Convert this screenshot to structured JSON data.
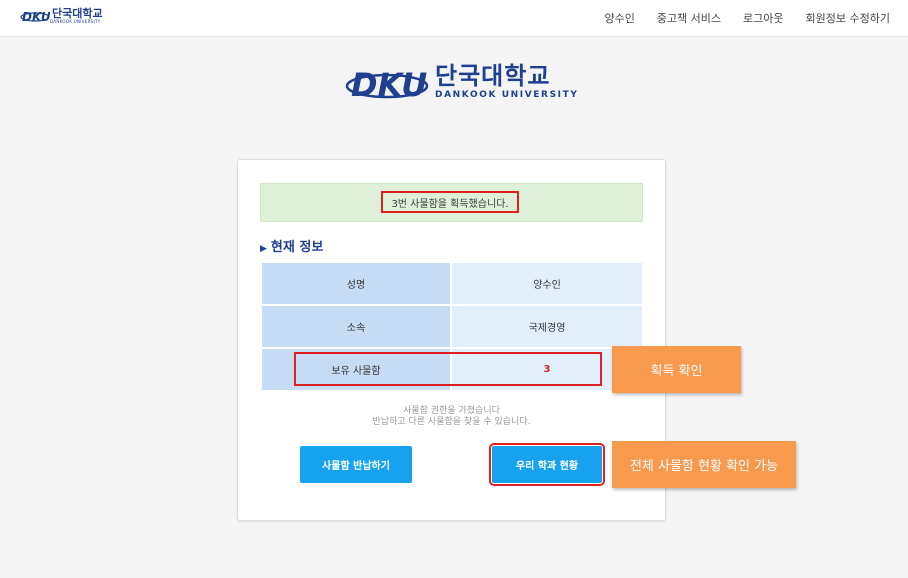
{
  "brand": {
    "top_logo_korean": "단국대학교",
    "top_logo_english": "DANKOOK UNIVERSITY",
    "hero_logo_korean": "단국대학교",
    "hero_logo_english": "DANKOOK UNIVERSITY",
    "color": "#1f3f8f"
  },
  "nav": {
    "user": "양수인",
    "used_books": "중고책 서비스",
    "logout": "로그아웃",
    "edit_profile": "회원정보 수정하기"
  },
  "alert": {
    "message": "3번 사물함을 획득했습니다."
  },
  "section": {
    "title": "현재 정보"
  },
  "info": {
    "rows": [
      {
        "label": "성명",
        "value": "양수인"
      },
      {
        "label": "소속",
        "value": "국제경영"
      },
      {
        "label": "보유 사물함",
        "value": "3"
      }
    ]
  },
  "notice": {
    "line1": "사물함 권한을 가졌습니다",
    "line2": "반납하고 다른 사물함을 찾을 수 있습니다."
  },
  "buttons": {
    "return_locker": "사물함 반납하기",
    "dept_status": "우리 학과 현황"
  },
  "callouts": {
    "acquire_check": "획득 확인",
    "overall_status": "전체 사물함 현황 확인 가능"
  },
  "colors": {
    "button": "#17a2f0",
    "highlight": "#e02020",
    "callout": "#f79a4d",
    "alert_bg": "#dff0d8"
  }
}
